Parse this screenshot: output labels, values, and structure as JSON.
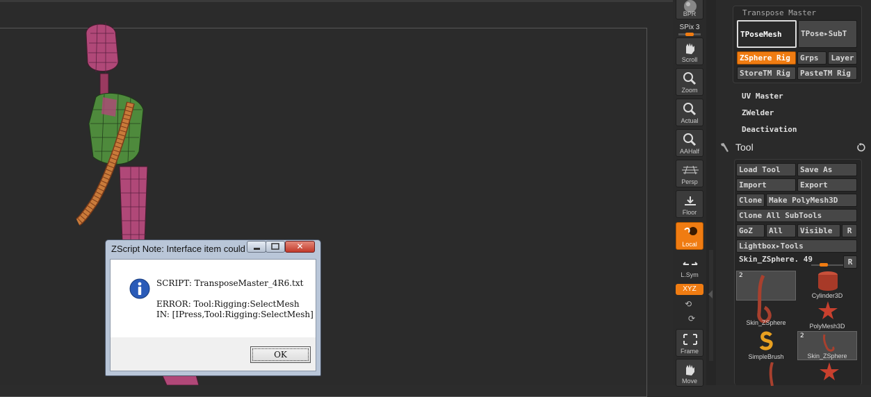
{
  "canvas": {},
  "shelf": {
    "bpr": "BPR",
    "spix_label": "SPix 3",
    "buttons": [
      {
        "label": "Scroll"
      },
      {
        "label": "Zoom"
      },
      {
        "label": "Actual"
      },
      {
        "label": "AAHalf"
      },
      {
        "label": "Persp"
      },
      {
        "label": "Floor"
      },
      {
        "label": "Local"
      },
      {
        "label": "L.Sym"
      },
      {
        "label": "Frame"
      },
      {
        "label": "Move"
      }
    ],
    "xyz": "XYZ",
    "active_color": "#f07c12"
  },
  "transpose": {
    "title": "Transpose Master",
    "tposemesh": "TPoseMesh",
    "tpose_subt": "TPose▸SubT",
    "zsphere_rig": "ZSphere Rig",
    "grps": "Grps",
    "layer": "Layer",
    "storetm": "StoreTM Rig",
    "pastetm": "PasteTM Rig"
  },
  "plugins": {
    "uv_master": "UV Master",
    "zwelder": "ZWelder",
    "deactivation": "Deactivation"
  },
  "tool": {
    "title": "Tool",
    "load_tool": "Load Tool",
    "save_as": "Save As",
    "import": "Import",
    "export": "Export",
    "clone": "Clone",
    "make_polymesh": "Make PolyMesh3D",
    "clone_all": "Clone All SubTools",
    "goz": "GoZ",
    "all": "All",
    "visible": "Visible",
    "r": "R",
    "lightbox": "Lightbox▸Tools",
    "current": "Skin_ZSphere. 49",
    "r2": "R",
    "thumbs": [
      {
        "label": "Skin_ZSphere",
        "count": "2"
      },
      {
        "label": "Cylinder3D"
      },
      {
        "label": "PolyMesh3D"
      },
      {
        "label": "SimpleBrush"
      },
      {
        "label": "Skin_ZSphere",
        "count": "2"
      }
    ]
  },
  "dialog": {
    "title": "ZScript Note: Interface item could not be fo...",
    "close": "✕",
    "script_line": "SCRIPT: TransposeMaster_4R6.txt",
    "error_line": "ERROR: Tool:Rigging:SelectMesh",
    "in_line": "IN: [IPress,Tool:Rigging:SelectMesh]",
    "ok": "OK"
  }
}
